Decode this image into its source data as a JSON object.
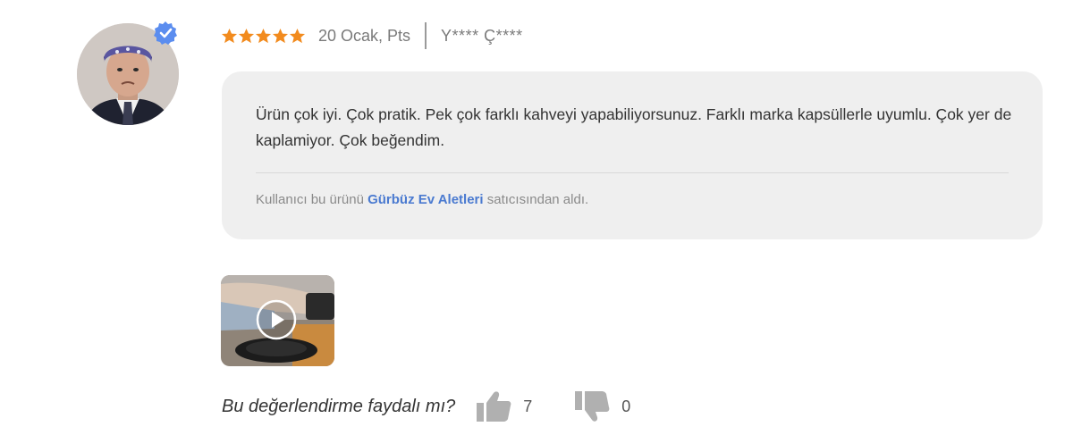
{
  "review": {
    "rating": 5,
    "rating_max": 5,
    "date": "20 Ocak, Pts",
    "author": "Y**** Ç****",
    "text": "Ürün çok iyi. Çok pratik. Pek çok farklı kahveyi yapabiliyorsunuz. Farklı marka kapsüllerle uyumlu. Çok yer de kaplamiyor. Çok beğendim.",
    "seller_prefix": "Kullanıcı bu ürünü",
    "seller_name": "Gürbüz Ev Aletleri",
    "seller_suffix": "satıcısından aldı."
  },
  "helpful": {
    "question": "Bu değerlendirme faydalı mı?",
    "likes": "7",
    "dislikes": "0"
  },
  "icons": {
    "star": "star-icon",
    "verified": "verified-badge-icon",
    "play": "play-icon",
    "like": "thumbs-up-icon",
    "dislike": "thumbs-down-icon"
  },
  "colors": {
    "star": "#f28b1e",
    "bubble": "#efefef",
    "seller_link": "#4a7ad0",
    "verified": "#5b8def"
  }
}
